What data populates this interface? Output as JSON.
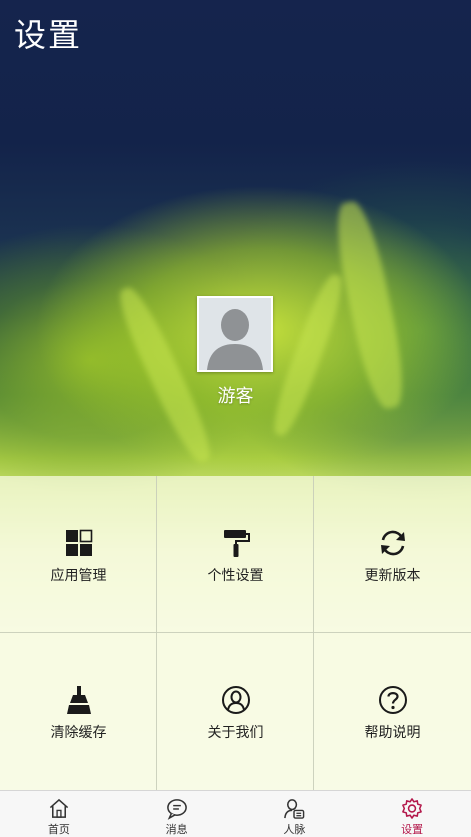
{
  "header": {
    "title": "设置"
  },
  "profile": {
    "name": "游客",
    "avatar_icon": "default-user-avatar"
  },
  "grid": [
    {
      "label": "应用管理",
      "icon": "app-grid-icon"
    },
    {
      "label": "个性设置",
      "icon": "paint-roller-icon"
    },
    {
      "label": "更新版本",
      "icon": "refresh-icon"
    },
    {
      "label": "清除缓存",
      "icon": "broom-icon"
    },
    {
      "label": "关于我们",
      "icon": "about-user-circle-icon"
    },
    {
      "label": "帮助说明",
      "icon": "help-circle-icon"
    }
  ],
  "bottom_nav": {
    "tabs": [
      {
        "label": "首页",
        "icon": "home-icon",
        "active": false
      },
      {
        "label": "消息",
        "icon": "chat-bubble-icon",
        "active": false
      },
      {
        "label": "人脉",
        "icon": "contacts-icon",
        "active": false
      },
      {
        "label": "设置",
        "icon": "gear-icon",
        "active": true
      }
    ]
  },
  "colors": {
    "active_tab": "#b3174a",
    "text_dark": "#222222"
  }
}
